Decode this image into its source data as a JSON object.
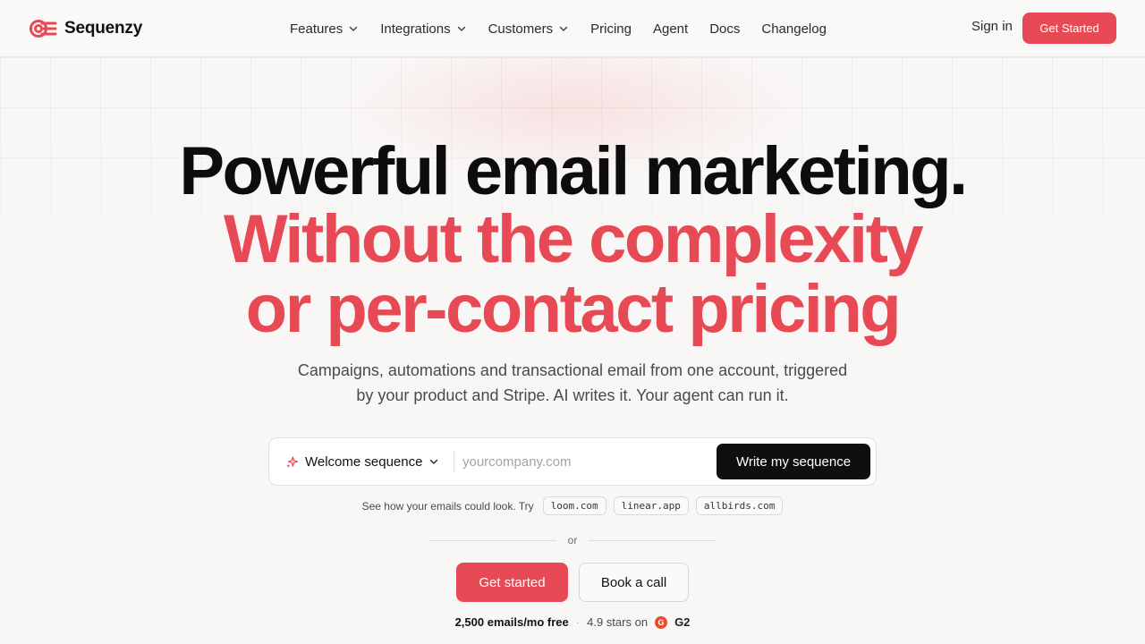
{
  "brand": {
    "name": "Sequenzy",
    "accent": "#e84a55"
  },
  "nav": {
    "items": [
      {
        "label": "Features",
        "dropdown": true
      },
      {
        "label": "Integrations",
        "dropdown": true
      },
      {
        "label": "Customers",
        "dropdown": true
      },
      {
        "label": "Pricing",
        "dropdown": false
      },
      {
        "label": "Agent",
        "dropdown": false
      },
      {
        "label": "Docs",
        "dropdown": false
      },
      {
        "label": "Changelog",
        "dropdown": false
      }
    ],
    "sign_in": "Sign in",
    "get_started": "Get Started"
  },
  "hero": {
    "line1": "Powerful email marketing.",
    "line2": "Without the complexity",
    "line3": "or per-contact pricing",
    "sub1": "Campaigns, automations and transactional email from one account, triggered",
    "sub2": "by your product and Stripe. AI writes it. Your agent can run it."
  },
  "form": {
    "select_value": "Welcome sequence",
    "input_placeholder": "yourcompany.com",
    "input_value": "",
    "submit": "Write my sequence"
  },
  "try": {
    "text": "See how your emails could look. Try",
    "examples": [
      "loom.com",
      "linear.app",
      "allbirds.com"
    ]
  },
  "or": "or",
  "actions": {
    "primary": "Get started",
    "secondary": "Book a call"
  },
  "meta": {
    "free": "2,500 emails/mo free",
    "separator": "·",
    "stars": "4.9 stars on",
    "g2_badge": "G",
    "g2": "G2"
  }
}
